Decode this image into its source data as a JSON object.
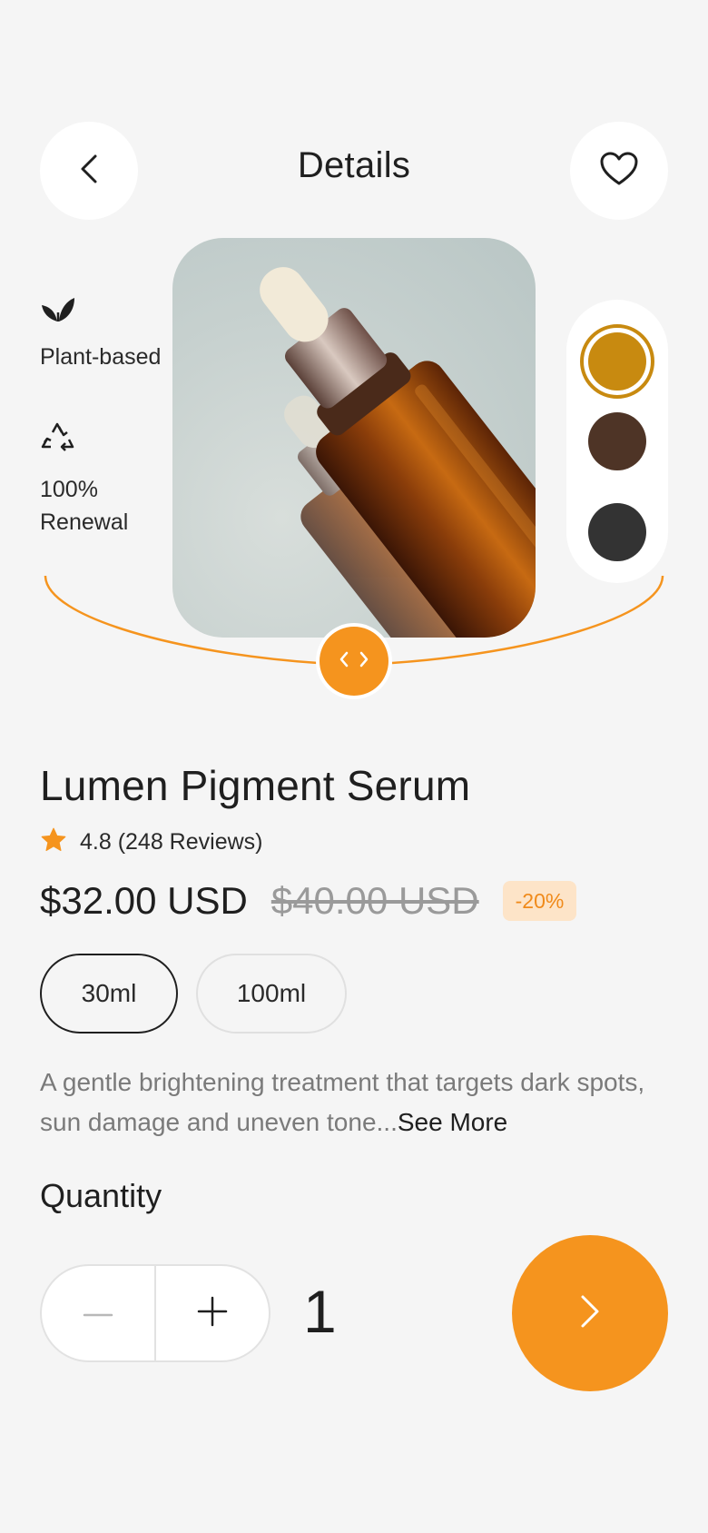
{
  "header": {
    "title": "Details",
    "back_icon": "chevron-left-icon",
    "favorite_icon": "heart-icon"
  },
  "features": [
    {
      "icon": "leaf-icon",
      "label": "Plant-based"
    },
    {
      "icon": "recycle-icon",
      "label": "100% Renewal"
    }
  ],
  "product_image": {
    "subject": "amber dropper serum bottles"
  },
  "swatches": [
    {
      "color": "#c88a10",
      "selected": true
    },
    {
      "color": "#4e3426",
      "selected": false
    },
    {
      "color": "#333333",
      "selected": false
    }
  ],
  "product": {
    "name": "Lumen Pigment Serum",
    "rating_text": "4.8 (248 Reviews)",
    "price": "$32.00 USD",
    "old_price": "$40.00 USD",
    "discount": "-20%"
  },
  "sizes": [
    {
      "label": "30ml",
      "selected": true
    },
    {
      "label": "100ml",
      "selected": false
    }
  ],
  "description": {
    "text": "A gentle brightening treatment that targets dark spots, sun damage and uneven tone...",
    "see_more": "See More"
  },
  "quantity": {
    "label": "Quantity",
    "value": "1"
  },
  "colors": {
    "accent": "#f5941e",
    "background": "#f5f5f5",
    "discount_bg": "#fde4c8"
  }
}
